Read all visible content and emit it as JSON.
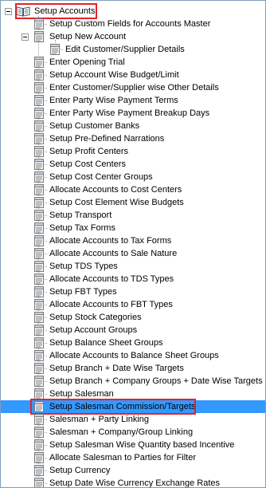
{
  "tree": {
    "root": {
      "label": "Setup Accounts",
      "expanded": true
    },
    "items": [
      {
        "label": "Setup Custom Fields for Accounts Master"
      },
      {
        "label": "Setup New Account",
        "expanded": true
      },
      {
        "label": "Edit Customer/Supplier Details"
      },
      {
        "label": "Enter Opening Trial"
      },
      {
        "label": "Setup Account Wise Budget/Limit"
      },
      {
        "label": "Enter Customer/Supplier wise Other Details"
      },
      {
        "label": "Enter Party Wise Payment Terms"
      },
      {
        "label": "Enter Party Wise Payment Breakup Days"
      },
      {
        "label": "Setup Customer Banks"
      },
      {
        "label": "Setup Pre-Defined Narrations"
      },
      {
        "label": "Setup Profit Centers"
      },
      {
        "label": "Setup Cost Centers"
      },
      {
        "label": "Setup Cost Center Groups"
      },
      {
        "label": "Allocate Accounts to Cost Centers"
      },
      {
        "label": "Setup Cost Element Wise Budgets"
      },
      {
        "label": "Setup Transport"
      },
      {
        "label": "Setup Tax Forms"
      },
      {
        "label": "Allocate Accounts to Tax Forms"
      },
      {
        "label": "Allocate Accounts to Sale Nature"
      },
      {
        "label": "Setup TDS Types"
      },
      {
        "label": "Allocate Accounts to TDS Types"
      },
      {
        "label": "Setup FBT Types"
      },
      {
        "label": "Allocate Accounts to FBT Types"
      },
      {
        "label": "Setup Stock Categories"
      },
      {
        "label": "Setup Account Groups"
      },
      {
        "label": "Setup Balance Sheet Groups"
      },
      {
        "label": "Allocate Accounts to Balance Sheet Groups"
      },
      {
        "label": "Setup Branch + Date Wise Targets"
      },
      {
        "label": "Setup Branch + Company Groups + Date Wise Targets"
      },
      {
        "label": "Setup Salesman"
      },
      {
        "label": "Setup Salesman Commission/Targets",
        "selected": true
      },
      {
        "label": "Salesman + Party Linking"
      },
      {
        "label": "Salesman + Company/Group Linking"
      },
      {
        "label": "Setup Salesman Wise Quantity based Incentive"
      },
      {
        "label": "Allocate Salesman to Parties for Filter"
      },
      {
        "label": "Setup Currency"
      },
      {
        "label": "Setup Date Wise Currency Exchange Rates"
      }
    ]
  },
  "colors": {
    "selection": "#3399ff",
    "highlight_box": "#e8202a",
    "border": "#7f9db9"
  },
  "icons": {
    "root": "open-book-icon",
    "item": "document-list-icon",
    "expander": "collapse-minus-icon"
  }
}
